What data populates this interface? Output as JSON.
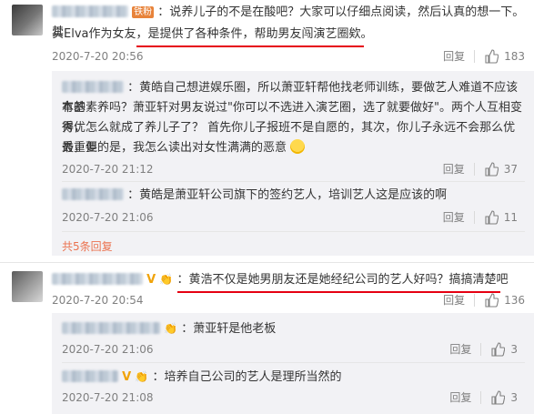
{
  "comments": [
    {
      "id": "c1",
      "badge": "铁粉",
      "text_line1": "：说养儿子的不是在酸吧？大家可以仔细点阅读，然后认真的想一下。其",
      "text_line2": "实Elva作为女友，是提供了各种条件，帮助男友闯演艺圈欸。",
      "time": "2020-7-20 20:56",
      "reply_label": "回复",
      "like_count": "183"
    },
    {
      "id": "c2",
      "text_line1": "：黄皓自己想进娱乐圈，所以萧亚轩帮他找老师训练，要做艺人难道不应该有基",
      "text_line2": "本的素养吗？萧亚轩对男友说过\"你可以不选进入演艺圈，选了就要做好\"。两个人互相变得优",
      "text_line3": "秀，怎么就成了养儿子了？ 首先你儿子报班不是自愿的，其次，你儿子永远不会那么优秀，但",
      "text_line4": "最重要的是，我怎么读出对女性满满的恶意",
      "time": "2020-7-20 21:12",
      "reply_label": "回复",
      "like_count": "37"
    },
    {
      "id": "c3",
      "text_line1": "：黄皓是萧亚轩公司旗下的签约艺人，培训艺人这是应该的啊",
      "time": "2020-7-20 21:06",
      "reply_label": "回复",
      "like_count": "11"
    },
    {
      "id": "more",
      "text": "共5条回复"
    },
    {
      "id": "c4",
      "text_line1": "：黄浩不仅是她男朋友还是她经纪公司的艺人好吗？搞搞清楚吧",
      "time": "2020-7-20 20:54",
      "reply_label": "回复",
      "like_count": "136"
    },
    {
      "id": "c5",
      "text_line1": "：萧亚轩是他老板",
      "time": "2020-7-20 21:06",
      "reply_label": "回复",
      "like_count": "3"
    },
    {
      "id": "c6",
      "text_line1": "：培养自己公司的艺人是理所当然的",
      "time": "2020-7-20 21:08",
      "reply_label": "回复",
      "like_count": "3"
    }
  ],
  "colors": {
    "highlight": "#e60012",
    "link": "#eb7350",
    "muted": "#808080",
    "reply_bg": "#f2f2f5"
  }
}
